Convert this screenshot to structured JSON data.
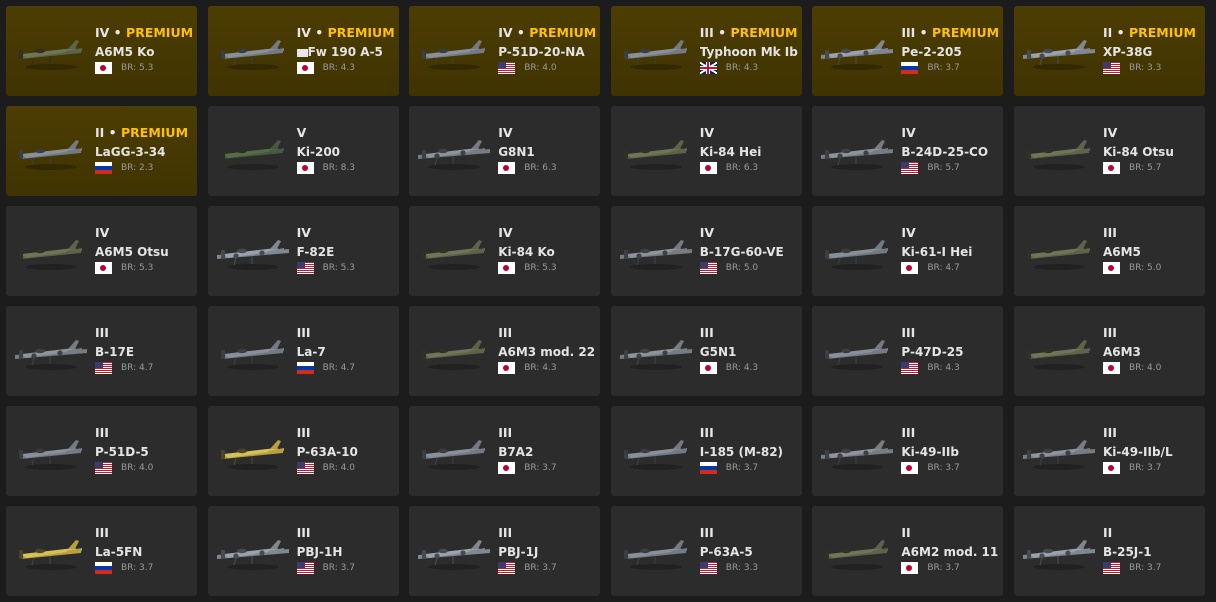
{
  "separator": " • ",
  "premium_label": "PREMIUM",
  "colors": {
    "premium_text": "#ffc107",
    "card_bg": "#2c2c2d",
    "premium_bg": "#4c3d02",
    "page_bg": "#1c1c1c"
  },
  "vehicles": [
    {
      "rank": "IV",
      "premium": true,
      "name": "A6M5 Ko",
      "country": "jp",
      "br": "BR: 5.3",
      "plane": "zero"
    },
    {
      "rank": "IV",
      "premium": true,
      "name": "Fw 190 A-5",
      "country": "jp",
      "br": "BR: 4.3",
      "plane": "fighter",
      "badge": "de"
    },
    {
      "rank": "IV",
      "premium": true,
      "name": "P-51D-20-NA",
      "country": "us",
      "br": "BR: 4.0",
      "plane": "fighter"
    },
    {
      "rank": "III",
      "premium": true,
      "name": "Typhoon Mk Ib",
      "country": "gb",
      "br": "BR: 4.3",
      "plane": "fighter"
    },
    {
      "rank": "III",
      "premium": true,
      "name": "Pe-2-205",
      "country": "ru",
      "br": "BR: 3.7",
      "plane": "twin"
    },
    {
      "rank": "II",
      "premium": true,
      "name": "XP-38G",
      "country": "us",
      "br": "BR: 3.3",
      "plane": "twin"
    },
    {
      "rank": "II",
      "premium": true,
      "name": "LaGG-3-34",
      "country": "ru",
      "br": "BR: 2.3",
      "plane": "fighter"
    },
    {
      "rank": "V",
      "premium": false,
      "name": "Ki-200",
      "country": "jp",
      "br": "BR: 8.3",
      "plane": "jet"
    },
    {
      "rank": "IV",
      "premium": false,
      "name": "G8N1",
      "country": "jp",
      "br": "BR: 6.3",
      "plane": "bomber"
    },
    {
      "rank": "IV",
      "premium": false,
      "name": "Ki-84 Hei",
      "country": "jp",
      "br": "BR: 6.3",
      "plane": "zero"
    },
    {
      "rank": "IV",
      "premium": false,
      "name": "B-24D-25-CO",
      "country": "us",
      "br": "BR: 5.7",
      "plane": "bomber"
    },
    {
      "rank": "IV",
      "premium": false,
      "name": "Ki-84 Otsu",
      "country": "jp",
      "br": "BR: 5.7",
      "plane": "zero"
    },
    {
      "rank": "IV",
      "premium": false,
      "name": "A6M5 Otsu",
      "country": "jp",
      "br": "BR: 5.3",
      "plane": "zero"
    },
    {
      "rank": "IV",
      "premium": false,
      "name": "F-82E",
      "country": "us",
      "br": "BR: 5.3",
      "plane": "twin"
    },
    {
      "rank": "IV",
      "premium": false,
      "name": "Ki-84 Ko",
      "country": "jp",
      "br": "BR: 5.3",
      "plane": "zero"
    },
    {
      "rank": "IV",
      "premium": false,
      "name": "B-17G-60-VE",
      "country": "us",
      "br": "BR: 5.0",
      "plane": "bomber"
    },
    {
      "rank": "IV",
      "premium": false,
      "name": "Ki-61-I Hei",
      "country": "jp",
      "br": "BR: 4.7",
      "plane": "fighter"
    },
    {
      "rank": "III",
      "premium": false,
      "name": "A6M5",
      "country": "jp",
      "br": "BR: 5.0",
      "plane": "zero"
    },
    {
      "rank": "III",
      "premium": false,
      "name": "B-17E",
      "country": "us",
      "br": "BR: 4.7",
      "plane": "bomber"
    },
    {
      "rank": "III",
      "premium": false,
      "name": "La-7",
      "country": "ru",
      "br": "BR: 4.7",
      "plane": "fighter"
    },
    {
      "rank": "III",
      "premium": false,
      "name": "A6M3 mod. 22",
      "country": "jp",
      "br": "BR: 4.3",
      "plane": "zero"
    },
    {
      "rank": "III",
      "premium": false,
      "name": "G5N1",
      "country": "jp",
      "br": "BR: 4.3",
      "plane": "bomber"
    },
    {
      "rank": "III",
      "premium": false,
      "name": "P-47D-25",
      "country": "us",
      "br": "BR: 4.3",
      "plane": "fighter"
    },
    {
      "rank": "III",
      "premium": false,
      "name": "A6M3",
      "country": "jp",
      "br": "BR: 4.0",
      "plane": "zero"
    },
    {
      "rank": "III",
      "premium": false,
      "name": "P-51D-5",
      "country": "us",
      "br": "BR: 4.0",
      "plane": "fighter"
    },
    {
      "rank": "III",
      "premium": false,
      "name": "P-63A-10",
      "country": "us",
      "br": "BR: 4.0",
      "plane": "yellow"
    },
    {
      "rank": "III",
      "premium": false,
      "name": "B7A2",
      "country": "jp",
      "br": "BR: 3.7",
      "plane": "fighter"
    },
    {
      "rank": "III",
      "premium": false,
      "name": "I-185 (M-82)",
      "country": "ru",
      "br": "BR: 3.7",
      "plane": "fighter"
    },
    {
      "rank": "III",
      "premium": false,
      "name": "Ki-49-IIb",
      "country": "jp",
      "br": "BR: 3.7",
      "plane": "bomber"
    },
    {
      "rank": "III",
      "premium": false,
      "name": "Ki-49-IIb/L",
      "country": "jp",
      "br": "BR: 3.7",
      "plane": "bomber"
    },
    {
      "rank": "III",
      "premium": false,
      "name": "La-5FN",
      "country": "ru",
      "br": "BR: 3.7",
      "plane": "yellow"
    },
    {
      "rank": "III",
      "premium": false,
      "name": "PBJ-1H",
      "country": "us",
      "br": "BR: 3.7",
      "plane": "twin"
    },
    {
      "rank": "III",
      "premium": false,
      "name": "PBJ-1J",
      "country": "us",
      "br": "BR: 3.7",
      "plane": "twin"
    },
    {
      "rank": "III",
      "premium": false,
      "name": "P-63A-5",
      "country": "us",
      "br": "BR: 3.3",
      "plane": "fighter"
    },
    {
      "rank": "II",
      "premium": false,
      "name": "A6M2 mod. 11",
      "country": "jp",
      "br": "BR: 3.7",
      "plane": "zero"
    },
    {
      "rank": "II",
      "premium": false,
      "name": "B-25J-1",
      "country": "us",
      "br": "BR: 3.7",
      "plane": "twin"
    }
  ]
}
